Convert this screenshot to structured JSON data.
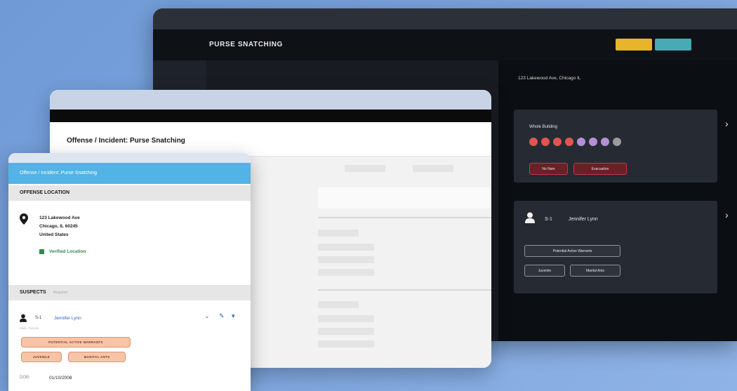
{
  "dark_window": {
    "title": "PURSE SNATCHING",
    "address": "123 Lakewood Ave, Chicago IL",
    "location_card": {
      "label": "Whole Building",
      "dots": [
        "#e0564f",
        "#e0564f",
        "#e0564f",
        "#e0564f",
        "#b48fd6",
        "#b48fd6",
        "#b48fd6",
        "#9a9a9a"
      ],
      "pills": [
        "No Nam",
        "Evacuation"
      ]
    },
    "suspect_card": {
      "id": "S-1",
      "name": "Jennifer Lynn",
      "pills": [
        "Potential Active Warrants",
        "Juvenile",
        "Marital Ants"
      ]
    }
  },
  "middle_window": {
    "title": "Offense / Incident: Purse Snatching"
  },
  "front_panel": {
    "header": "Offense / Incident: Purse Snatching",
    "offense_location": {
      "heading": "OFFENSE LOCATION",
      "address_lines": [
        "123 Lakewood Ave",
        "Chicago, IL 60245",
        "United States"
      ],
      "verified": "Verified Location"
    },
    "suspects": {
      "heading": "SUSPECTS",
      "sub": "Required",
      "id": "S-1",
      "name": "Jennifer Lynn",
      "sub_text": "Male, Female",
      "tags": [
        "POTENTIAL ACTIVE WARRANTS",
        "JUVENILE",
        "MARITAL ANTS"
      ],
      "dob_label": "DOB:",
      "dob_value": "01/10/2008"
    }
  },
  "colors": {
    "accent_blue": "#51b3e6",
    "verified_green": "#2e8c4b",
    "tag_orange": "#f6c4a7",
    "yellow_button": "#e7b42c",
    "teal_button": "#47aab5"
  }
}
